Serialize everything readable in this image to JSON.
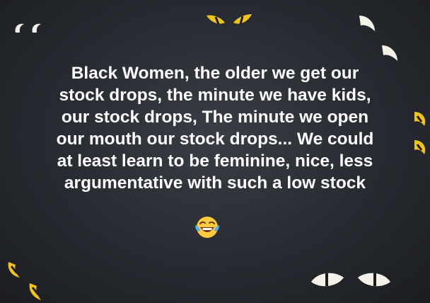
{
  "post": {
    "lines": [
      "Black Women, the older we get our",
      "stock drops, the minute we have kids,",
      "our stock drops, The minute we open",
      "our mouth our stock drops... We could",
      "at least learn to be feminine, nice, less",
      "argumentative with such a low stock"
    ],
    "emoji": "tears-of-joy-emoji"
  },
  "background": {
    "theme": "dark with glowing eyes",
    "eye_color": "#f0c419",
    "white_eye_color": "#f4f1e6"
  }
}
